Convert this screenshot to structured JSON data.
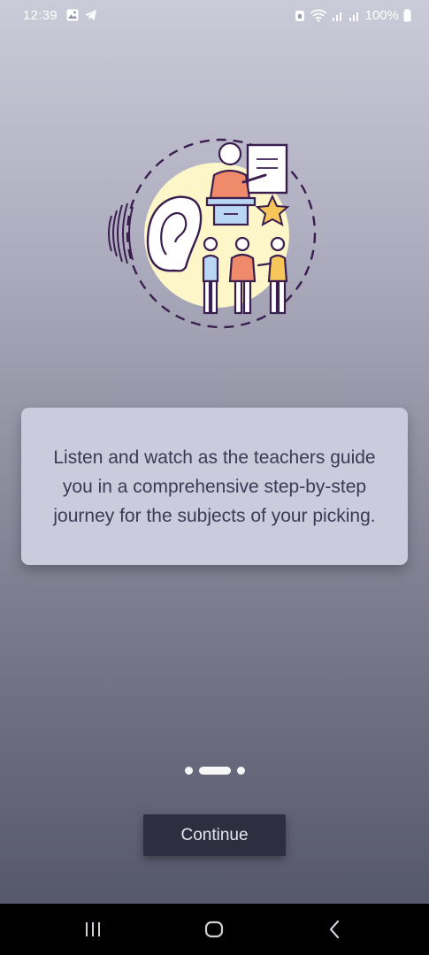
{
  "status_bar": {
    "time": "12:39",
    "battery": "100%",
    "left_icons": [
      "gallery-icon",
      "telegram-icon"
    ],
    "right_icons": [
      "nfc-icon",
      "wifi-icon",
      "signal-icon",
      "signal-icon",
      "battery-icon"
    ]
  },
  "illustration": {
    "name": "teacher-listening-illustration",
    "colors": {
      "circle": "#fdf6c8",
      "outline": "#3b1e50",
      "accent": "#ef8a6a",
      "blue": "#b9d6f2",
      "star": "#f7c65b"
    }
  },
  "onboarding": {
    "message": "Listen and watch as the teachers guide you in a comprehensive step-by-step journey for the subjects of your picking.",
    "page_count": 3,
    "active_page": 2,
    "continue_label": "Continue"
  },
  "nav_bar": {
    "recents_icon": "recents-icon",
    "home_icon": "home-icon",
    "back_icon": "back-icon"
  },
  "colors": {
    "card_background": "#cccbdd",
    "message_text": "#3a3a55",
    "button_background": "#2e2e40",
    "button_text": "#e6e6ee"
  }
}
